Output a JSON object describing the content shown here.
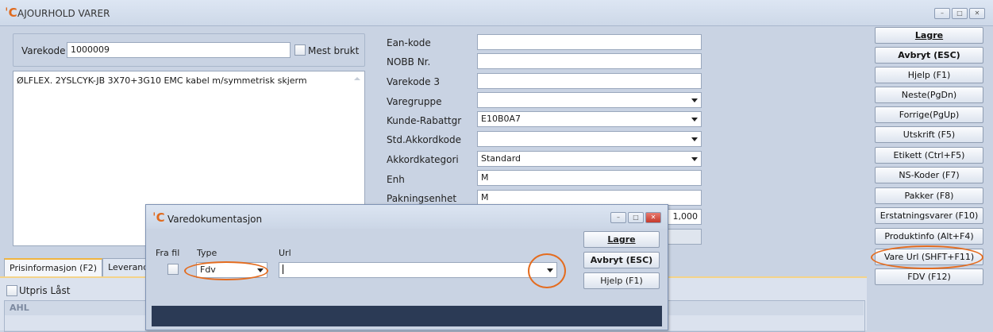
{
  "window": {
    "title": "AJOURHOLD VARER"
  },
  "form": {
    "varekode_label": "Varekode",
    "varekode_value": "1000009",
    "mest_brukt_label": "Mest brukt",
    "description": "ØLFLEX. 2YSLCYK-JB 3X70+3G10 EMC kabel m/symmetrisk skjerm",
    "fields": [
      {
        "label": "Ean-kode",
        "value": ""
      },
      {
        "label": "NOBB Nr.",
        "value": ""
      },
      {
        "label": "Varekode 3",
        "value": ""
      },
      {
        "label": "Varegruppe",
        "value": ""
      },
      {
        "label": "Kunde-Rabattgr",
        "value": "E10B0A7"
      },
      {
        "label": "Std.Akkordkode",
        "value": ""
      },
      {
        "label": "Akkordkategori",
        "value": "Standard"
      },
      {
        "label": "Enh",
        "value": "M"
      },
      {
        "label": "Pakningsenhet",
        "value": "M"
      }
    ],
    "extra_value": "1,000"
  },
  "buttons": [
    "Lagre",
    "Avbryt (ESC)",
    "Hjelp (F1)",
    "Neste(PgDn)",
    "Forrige(PgUp)",
    "Utskrift (F5)",
    "Etikett (Ctrl+F5)",
    "NS-Koder (F7)",
    "Pakker (F8)",
    "Erstatningsvarer (F10)",
    "Produktinfo (Alt+F4)",
    "Vare Url (SHFT+F11)",
    "FDV (F12)"
  ],
  "tabs": [
    "Prisinformasjon (F2)",
    "Leverand"
  ],
  "utpris_label": "Utpris Låst",
  "section_title": "AHL",
  "dialog": {
    "title": "Varedokumentasjon",
    "fra_fil_label": "Fra fil",
    "type_label": "Type",
    "url_label": "Url",
    "type_value": "Fdv",
    "url_value": "",
    "buttons": [
      "Lagre",
      "Avbryt (ESC)",
      "Hjelp (F1)"
    ]
  },
  "colors": {
    "accent": "#e46c1f",
    "background": "#c9d3e3"
  }
}
